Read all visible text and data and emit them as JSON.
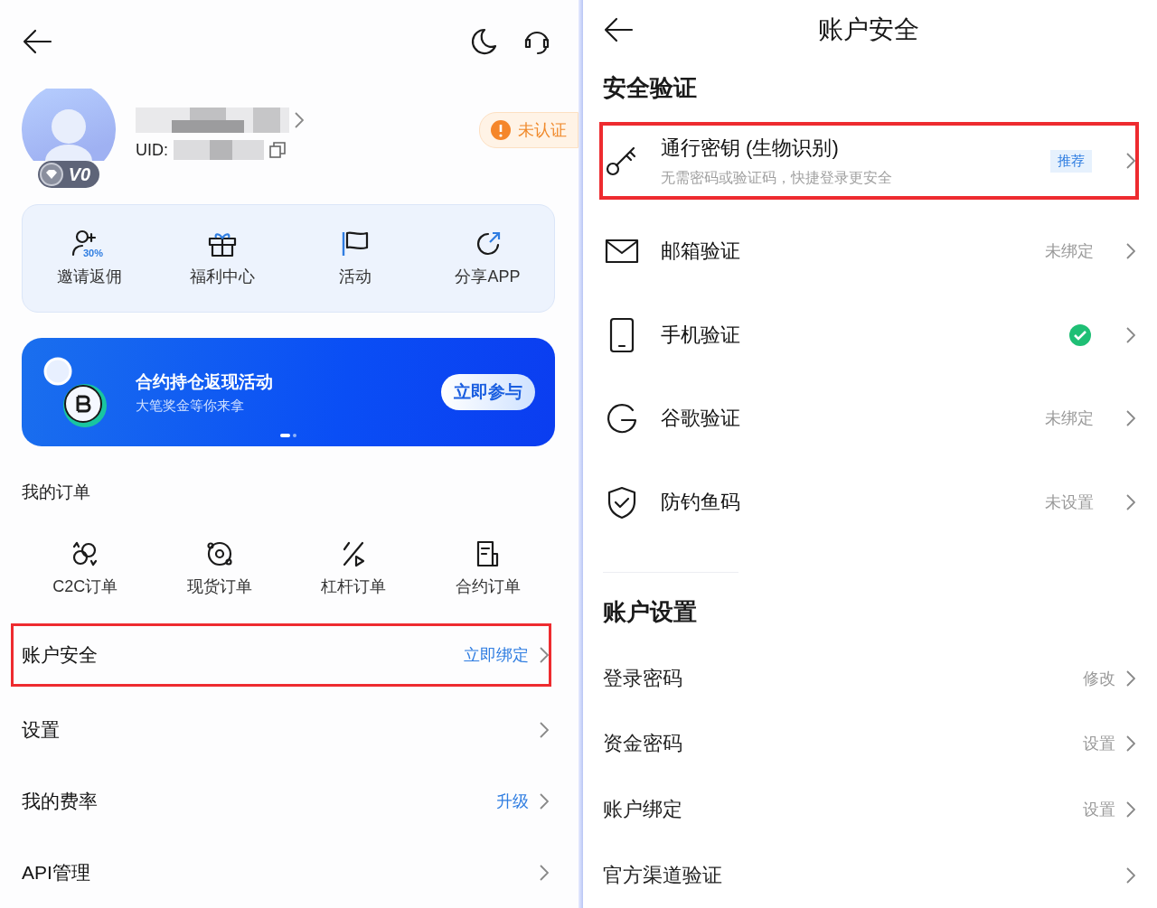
{
  "profile_screen": {
    "profile": {
      "level_badge": "V0",
      "uid_label": "UID:",
      "verify_badge": "未认证"
    },
    "quick_actions": [
      {
        "kind": "invite",
        "label": "邀请返佣",
        "tag": "30%"
      },
      {
        "kind": "gift",
        "label": "福利中心"
      },
      {
        "kind": "flag",
        "label": "活动"
      },
      {
        "kind": "share",
        "label": "分享APP"
      }
    ],
    "banner": {
      "title": "合约持仓返现活动",
      "subtitle": "大笔奖金等你来拿",
      "button": "立即参与",
      "pages": [
        {
          "selected": true
        },
        {
          "selected": false
        }
      ]
    },
    "orders": {
      "title": "我的订单",
      "items": [
        {
          "kind": "c2c",
          "label": "C2C订单"
        },
        {
          "kind": "spot",
          "label": "现货订单"
        },
        {
          "kind": "margin",
          "label": "杠杆订单"
        },
        {
          "kind": "contract",
          "label": "合约订单"
        }
      ]
    },
    "menu": [
      {
        "label": "账户安全",
        "value": "立即绑定",
        "highlighted": true
      },
      {
        "label": "设置",
        "highlighted": false
      },
      {
        "label": "我的费率",
        "value": "升级",
        "highlighted": false
      },
      {
        "label": "API管理",
        "highlighted": false
      }
    ]
  },
  "security_screen": {
    "title": "账户安全",
    "sections": [
      {
        "title": "安全验证",
        "items": [
          {
            "kind": "key",
            "label": "通行密钥 (生物识别)",
            "subtitle": "无需密码或验证码，快捷登录更安全",
            "tag": "推荐",
            "highlighted": true,
            "verified": false
          },
          {
            "kind": "mail",
            "label": "邮箱验证",
            "value": "未绑定",
            "highlighted": false,
            "verified": false
          },
          {
            "kind": "phone",
            "label": "手机验证",
            "highlighted": false,
            "verified": true
          },
          {
            "kind": "google",
            "label": "谷歌验证",
            "value": "未绑定",
            "highlighted": false,
            "verified": false
          },
          {
            "kind": "shield",
            "label": "防钓鱼码",
            "value": "未设置",
            "highlighted": false,
            "verified": false
          }
        ]
      },
      {
        "title": "账户设置",
        "items": [
          {
            "kind": "plain",
            "label": "登录密码",
            "value": "修改",
            "highlighted": false,
            "verified": false
          },
          {
            "kind": "plain",
            "label": "资金密码",
            "value": "设置",
            "highlighted": false,
            "verified": false
          },
          {
            "kind": "plain",
            "label": "账户绑定",
            "value": "设置",
            "highlighted": false,
            "verified": false
          },
          {
            "kind": "plain",
            "label": "官方渠道验证",
            "highlighted": false,
            "verified": false
          }
        ]
      }
    ]
  }
}
